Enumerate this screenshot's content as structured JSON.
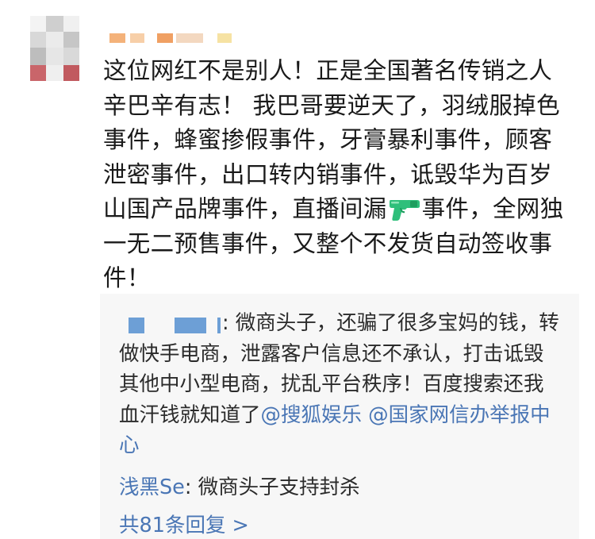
{
  "comment": {
    "lines": [
      "这位网红不是别人！正是全国著名传销之人",
      "辛巴辛有志！ 我巴哥要逆天了，羽绒服掉色",
      "事件，蜂蜜掺假事件，牙膏暴利事件，顾客",
      "泄密事件，出口转内销事件，诋毁华为百岁",
      "山国产品牌事件，直播间漏",
      "事件，全网独",
      "一无二预售事件，又整个不发货自动签收事",
      "件！"
    ],
    "emoji_icon": "water-pistol-icon"
  },
  "replies": {
    "reply1": {
      "name_suffix": ":",
      "text_1": " 微商头子，还骗了很多宝妈的钱，转做快手电商，泄露客户信息还不承认，打击诋毁其他中小型电商，扰乱平台秩序！百度搜索还我血汗钱就知道了",
      "mention_1": "@搜狐娱乐",
      "mention_2": "@国家网信办举报中心"
    },
    "reply2": {
      "nickname": "浅黑Se",
      "text": ": 微商头子支持封杀"
    },
    "more_label": "共81条回复 >"
  },
  "colors": {
    "link": "#4a76b5",
    "reply_bg": "#f7f7f7",
    "text": "#1a1a1a"
  }
}
